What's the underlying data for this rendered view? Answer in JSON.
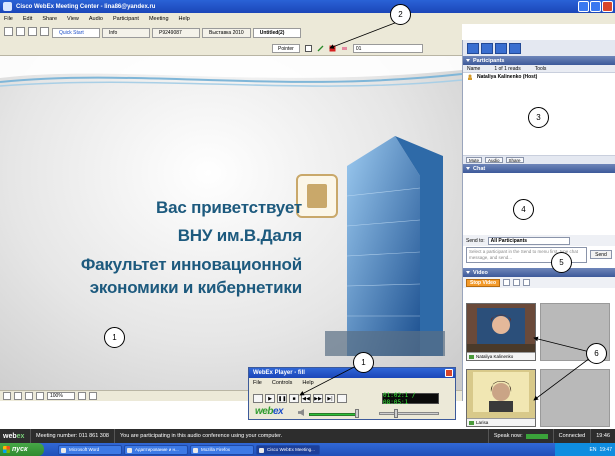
{
  "window": {
    "title": "Cisco WebEx Meeting Center - lina86@yandex.ru"
  },
  "menu": [
    "File",
    "Edit",
    "Share",
    "View",
    "Audio",
    "Participant",
    "Meeting",
    "Help"
  ],
  "doc_tabs": [
    "Quick Start",
    "Info",
    "P9249087",
    "Выставка 2010",
    "Untitled(2)"
  ],
  "annotate": {
    "pointer_label": "Pointer",
    "page_value": "01"
  },
  "slide": {
    "line1": "Вас приветствует",
    "line2": "ВНУ им.В.Даля",
    "line3": "Факультет инновационной",
    "line4": "экономики и кибернетики"
  },
  "zoom": "100%",
  "participants": {
    "header": "Participants",
    "col_name": "Name",
    "count": "1 of 1 reads",
    "col_tools": "Tools",
    "rows": [
      "Nataliya Kalinenko (Host)"
    ],
    "controls": [
      "Mute",
      "Audio",
      "Share"
    ]
  },
  "chat": {
    "header": "Chat",
    "send_to_label": "Send to:",
    "send_to_value": "All Participants",
    "placeholder": "Select a participant in the Send to menu first, type chat message, and send...",
    "send_button": "Send"
  },
  "video": {
    "header": "Video",
    "stop_label": "Stop Video",
    "thumbs": [
      "Nataliya Kalinenko",
      "Larisa"
    ]
  },
  "player": {
    "title": "WebEx Player - fill",
    "menu": [
      "File",
      "Controls",
      "Help"
    ],
    "time": "01:02:1 / 08:05:1",
    "brand_web": "web",
    "brand_ex": "ex"
  },
  "status": {
    "brand_web": "web",
    "brand_ex": "ex",
    "meeting": "Meeting number: 011 861 308",
    "audio": "You are participating in this audio conference using your computer.",
    "speak_now": "Speak now:",
    "connected": "Connected",
    "time": "19:46"
  },
  "taskbar": {
    "start": "пуск",
    "buttons": [
      "Microsoft Word",
      "Адаптирование и н...",
      "Mozilla Firefox",
      "Cisco WebEx Meeting..."
    ],
    "lang": "EN",
    "clock": "19:47"
  },
  "callouts": [
    "1",
    "2",
    "3",
    "4",
    "5",
    "6"
  ],
  "colors": {
    "titlebar": "#2a62d6",
    "slide_text": "#1d5a7e",
    "accent_orange": "#f39a2a",
    "webex_green": "#2f9b2f"
  }
}
